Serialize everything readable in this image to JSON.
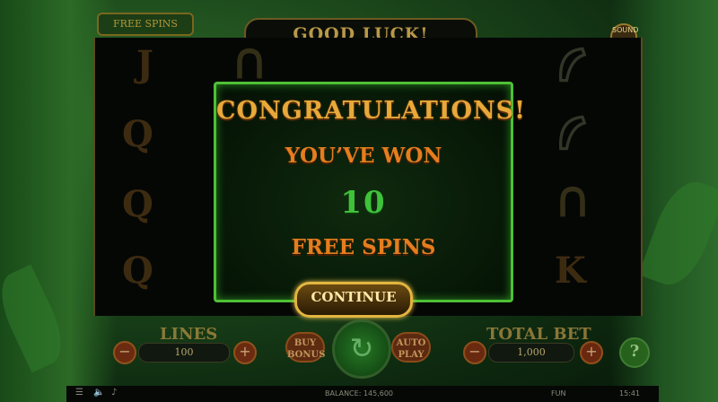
{
  "header": {
    "free_tag": "FREE SPINS",
    "title": "GOOD LUCK!",
    "badge": "SOUND"
  },
  "reel_symbols": {
    "col1": [
      "J",
      "Q",
      "Q",
      "Q"
    ],
    "col5": [
      "K"
    ]
  },
  "modal": {
    "heading": "CONGRATULATIONS!",
    "line1": "YOU’VE WON",
    "count": "10",
    "line2": "FREE SPINS",
    "continue_label": "CONTINUE"
  },
  "controls": {
    "lines_label": "LINES",
    "lines_value": "100",
    "minus": "−",
    "plus": "+",
    "buy_label": "BUY\nBONUS",
    "auto_label": "AUTO\nPLAY",
    "spin_icon": "↻",
    "total_bet_label": "TOTAL BET",
    "total_bet_value": "1,000",
    "help_label": "?"
  },
  "status": {
    "balance": "BALANCE: 145,600",
    "mode": "FUN",
    "time": "15:41"
  },
  "colors": {
    "modal_border": "#4fbf36",
    "gold": "#e7a93a",
    "orange": "#e57d1e",
    "green_count": "#3fc23a"
  }
}
